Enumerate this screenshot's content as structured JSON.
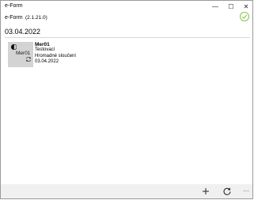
{
  "window": {
    "title": "e-Form",
    "minimize_glyph": "—",
    "maximize_glyph": "☐",
    "close_glyph": "✕"
  },
  "app": {
    "name": "e-Form",
    "version": "(2.1.21.0)",
    "status_icon": "check-circle-icon",
    "accent_color": "#8bc34a"
  },
  "list": {
    "date_header": "03.04.2022",
    "items": [
      {
        "thumb_label": "Mer01",
        "name": "Mer01",
        "line2": "Testovací",
        "line3": "Hromadné sloučení",
        "date": "03.04.2022"
      }
    ]
  },
  "bottom_bar": {
    "add_icon": "plus-icon",
    "refresh_icon": "refresh-icon",
    "more_label": "···"
  }
}
